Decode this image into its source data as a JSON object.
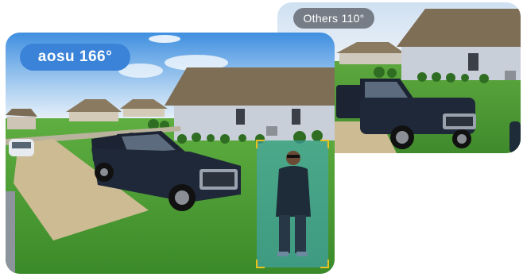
{
  "back_view": {
    "badge_label": "Others 110°"
  },
  "front_view": {
    "badge_label": "aosu 166°"
  },
  "colors": {
    "badge_front_bg": "#3a83d8",
    "badge_back_bg": "#50545c",
    "detection_box": "#e8c020",
    "detection_tint": "#3fa8c8",
    "truck": "#1c2433",
    "lawn": "#4e9a35",
    "driveway": "#cdbb93",
    "house_wall": "#c9cfd8",
    "roof": "#7f6e56"
  },
  "detection": {
    "label": ""
  }
}
